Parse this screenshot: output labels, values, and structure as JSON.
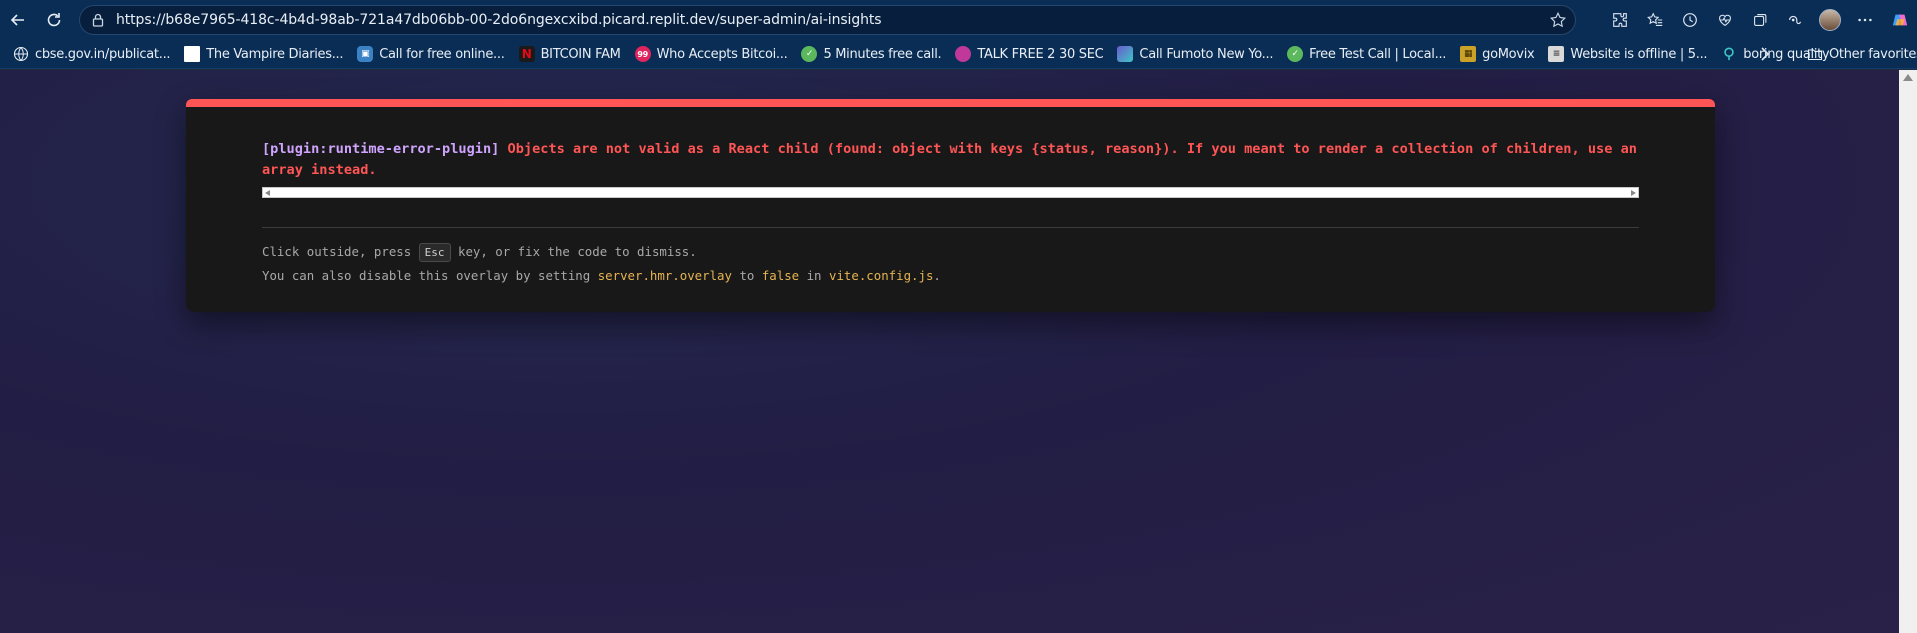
{
  "browser": {
    "url_base": "https://b68e7965-418c-4b4d-98ab-721a47db06bb-00-2do6ngexcxibd.picard.replit.dev",
    "url_path": "/super-admin/ai-insights"
  },
  "bookmarks": [
    {
      "label": "cbse.gov.in/publicat...",
      "icon": "globe-icon",
      "color": "#0a2d55"
    },
    {
      "label": "The Vampire Diaries...",
      "icon": "blank-page-icon",
      "color": "#ffffff"
    },
    {
      "label": "Call for free online...",
      "icon": "phone-app-icon",
      "color": "#3b82c4"
    },
    {
      "label": "BITCOIN FAM",
      "icon": "netflix-icon",
      "color": "#e50914"
    },
    {
      "label": "Who Accepts Bitcoi...",
      "icon": "badge-99-icon",
      "color": "#e0245e"
    },
    {
      "label": "5 Minutes free call.",
      "icon": "chat-bubble-icon",
      "color": "#5cb85c"
    },
    {
      "label": "TALK FREE 2 30 SEC",
      "icon": "circle-icon",
      "color": "#c0399a"
    },
    {
      "label": "Call Fumoto New Yo...",
      "icon": "chart-icon",
      "color": "#6a5acd"
    },
    {
      "label": "Free Test Call | Local...",
      "icon": "chat-bubble-icon",
      "color": "#5cb85c"
    },
    {
      "label": "goMovix",
      "icon": "film-icon",
      "color": "#c9a227"
    },
    {
      "label": "Website is offline | 5...",
      "icon": "document-icon",
      "color": "#d9d9d9"
    },
    {
      "label": "boring quality",
      "icon": "pin-icon",
      "color": "#3ec7c7"
    }
  ],
  "other_favorites": "Other favorites",
  "error": {
    "plugin": "[plugin:runtime-error-plugin]",
    "message": "Objects are not valid as a React child (found: object with keys {status, reason}). If you meant to render a collection of children, use an array instead.",
    "tip_before_key": "Click outside, press ",
    "key": "Esc",
    "tip_after_key": " key, or fix the code to dismiss.",
    "tip2_a": "You can also disable this overlay by setting ",
    "tip2_code1": "server.hmr.overlay",
    "tip2_b": " to ",
    "tip2_code2": "false",
    "tip2_c": " in ",
    "tip2_code3": "vite.config.js",
    "tip2_d": "."
  },
  "colors": {
    "accent_error": "#ff5555",
    "plugin_text": "#cfa4ff",
    "code_highlight": "#e6b450"
  }
}
